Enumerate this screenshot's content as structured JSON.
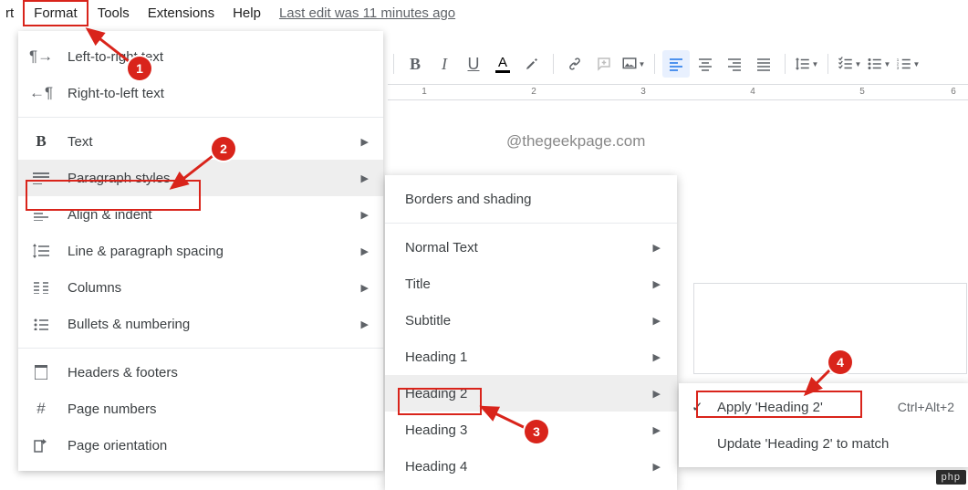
{
  "menubar": {
    "cutoff_left": "rt",
    "format": "Format",
    "tools": "Tools",
    "extensions": "Extensions",
    "help": "Help",
    "last_edit": "Last edit was 11 minutes ago"
  },
  "ruler": {
    "n1": "1",
    "n2": "2",
    "n3": "3",
    "n4": "4",
    "n5": "5",
    "n6": "6"
  },
  "doc": {
    "mention_hint": "@thegeekpage.com"
  },
  "format_menu": {
    "ltr": "Left-to-right text",
    "rtl": "Right-to-left text",
    "text": "Text",
    "paragraph_styles": "Paragraph styles",
    "align_indent": "Align & indent",
    "line_spacing": "Line & paragraph spacing",
    "columns": "Columns",
    "bullets_numbering": "Bullets & numbering",
    "headers_footers": "Headers & footers",
    "page_numbers": "Page numbers",
    "page_orientation": "Page orientation"
  },
  "para_styles_menu": {
    "borders_shading": "Borders and shading",
    "normal_text": "Normal Text",
    "title": "Title",
    "subtitle": "Subtitle",
    "h1": "Heading 1",
    "h2": "Heading 2",
    "h3": "Heading 3",
    "h4": "Heading 4"
  },
  "apply_menu": {
    "apply_h2": "Apply 'Heading 2'",
    "apply_shortcut": "Ctrl+Alt+2",
    "update_h2": "Update 'Heading 2' to match"
  },
  "annotations": {
    "b1": "1",
    "b2": "2",
    "b3": "3",
    "b4": "4"
  },
  "watermark": "php"
}
